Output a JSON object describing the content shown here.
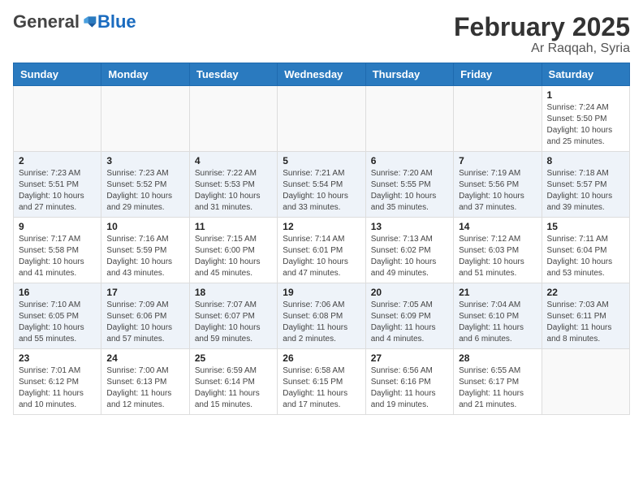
{
  "header": {
    "logo_general": "General",
    "logo_blue": "Blue",
    "title": "February 2025",
    "subtitle": "Ar Raqqah, Syria"
  },
  "calendar": {
    "days_of_week": [
      "Sunday",
      "Monday",
      "Tuesday",
      "Wednesday",
      "Thursday",
      "Friday",
      "Saturday"
    ],
    "weeks": [
      [
        {
          "day": "",
          "info": ""
        },
        {
          "day": "",
          "info": ""
        },
        {
          "day": "",
          "info": ""
        },
        {
          "day": "",
          "info": ""
        },
        {
          "day": "",
          "info": ""
        },
        {
          "day": "",
          "info": ""
        },
        {
          "day": "1",
          "info": "Sunrise: 7:24 AM\nSunset: 5:50 PM\nDaylight: 10 hours and 25 minutes."
        }
      ],
      [
        {
          "day": "2",
          "info": "Sunrise: 7:23 AM\nSunset: 5:51 PM\nDaylight: 10 hours and 27 minutes."
        },
        {
          "day": "3",
          "info": "Sunrise: 7:23 AM\nSunset: 5:52 PM\nDaylight: 10 hours and 29 minutes."
        },
        {
          "day": "4",
          "info": "Sunrise: 7:22 AM\nSunset: 5:53 PM\nDaylight: 10 hours and 31 minutes."
        },
        {
          "day": "5",
          "info": "Sunrise: 7:21 AM\nSunset: 5:54 PM\nDaylight: 10 hours and 33 minutes."
        },
        {
          "day": "6",
          "info": "Sunrise: 7:20 AM\nSunset: 5:55 PM\nDaylight: 10 hours and 35 minutes."
        },
        {
          "day": "7",
          "info": "Sunrise: 7:19 AM\nSunset: 5:56 PM\nDaylight: 10 hours and 37 minutes."
        },
        {
          "day": "8",
          "info": "Sunrise: 7:18 AM\nSunset: 5:57 PM\nDaylight: 10 hours and 39 minutes."
        }
      ],
      [
        {
          "day": "9",
          "info": "Sunrise: 7:17 AM\nSunset: 5:58 PM\nDaylight: 10 hours and 41 minutes."
        },
        {
          "day": "10",
          "info": "Sunrise: 7:16 AM\nSunset: 5:59 PM\nDaylight: 10 hours and 43 minutes."
        },
        {
          "day": "11",
          "info": "Sunrise: 7:15 AM\nSunset: 6:00 PM\nDaylight: 10 hours and 45 minutes."
        },
        {
          "day": "12",
          "info": "Sunrise: 7:14 AM\nSunset: 6:01 PM\nDaylight: 10 hours and 47 minutes."
        },
        {
          "day": "13",
          "info": "Sunrise: 7:13 AM\nSunset: 6:02 PM\nDaylight: 10 hours and 49 minutes."
        },
        {
          "day": "14",
          "info": "Sunrise: 7:12 AM\nSunset: 6:03 PM\nDaylight: 10 hours and 51 minutes."
        },
        {
          "day": "15",
          "info": "Sunrise: 7:11 AM\nSunset: 6:04 PM\nDaylight: 10 hours and 53 minutes."
        }
      ],
      [
        {
          "day": "16",
          "info": "Sunrise: 7:10 AM\nSunset: 6:05 PM\nDaylight: 10 hours and 55 minutes."
        },
        {
          "day": "17",
          "info": "Sunrise: 7:09 AM\nSunset: 6:06 PM\nDaylight: 10 hours and 57 minutes."
        },
        {
          "day": "18",
          "info": "Sunrise: 7:07 AM\nSunset: 6:07 PM\nDaylight: 10 hours and 59 minutes."
        },
        {
          "day": "19",
          "info": "Sunrise: 7:06 AM\nSunset: 6:08 PM\nDaylight: 11 hours and 2 minutes."
        },
        {
          "day": "20",
          "info": "Sunrise: 7:05 AM\nSunset: 6:09 PM\nDaylight: 11 hours and 4 minutes."
        },
        {
          "day": "21",
          "info": "Sunrise: 7:04 AM\nSunset: 6:10 PM\nDaylight: 11 hours and 6 minutes."
        },
        {
          "day": "22",
          "info": "Sunrise: 7:03 AM\nSunset: 6:11 PM\nDaylight: 11 hours and 8 minutes."
        }
      ],
      [
        {
          "day": "23",
          "info": "Sunrise: 7:01 AM\nSunset: 6:12 PM\nDaylight: 11 hours and 10 minutes."
        },
        {
          "day": "24",
          "info": "Sunrise: 7:00 AM\nSunset: 6:13 PM\nDaylight: 11 hours and 12 minutes."
        },
        {
          "day": "25",
          "info": "Sunrise: 6:59 AM\nSunset: 6:14 PM\nDaylight: 11 hours and 15 minutes."
        },
        {
          "day": "26",
          "info": "Sunrise: 6:58 AM\nSunset: 6:15 PM\nDaylight: 11 hours and 17 minutes."
        },
        {
          "day": "27",
          "info": "Sunrise: 6:56 AM\nSunset: 6:16 PM\nDaylight: 11 hours and 19 minutes."
        },
        {
          "day": "28",
          "info": "Sunrise: 6:55 AM\nSunset: 6:17 PM\nDaylight: 11 hours and 21 minutes."
        },
        {
          "day": "",
          "info": ""
        }
      ]
    ]
  }
}
